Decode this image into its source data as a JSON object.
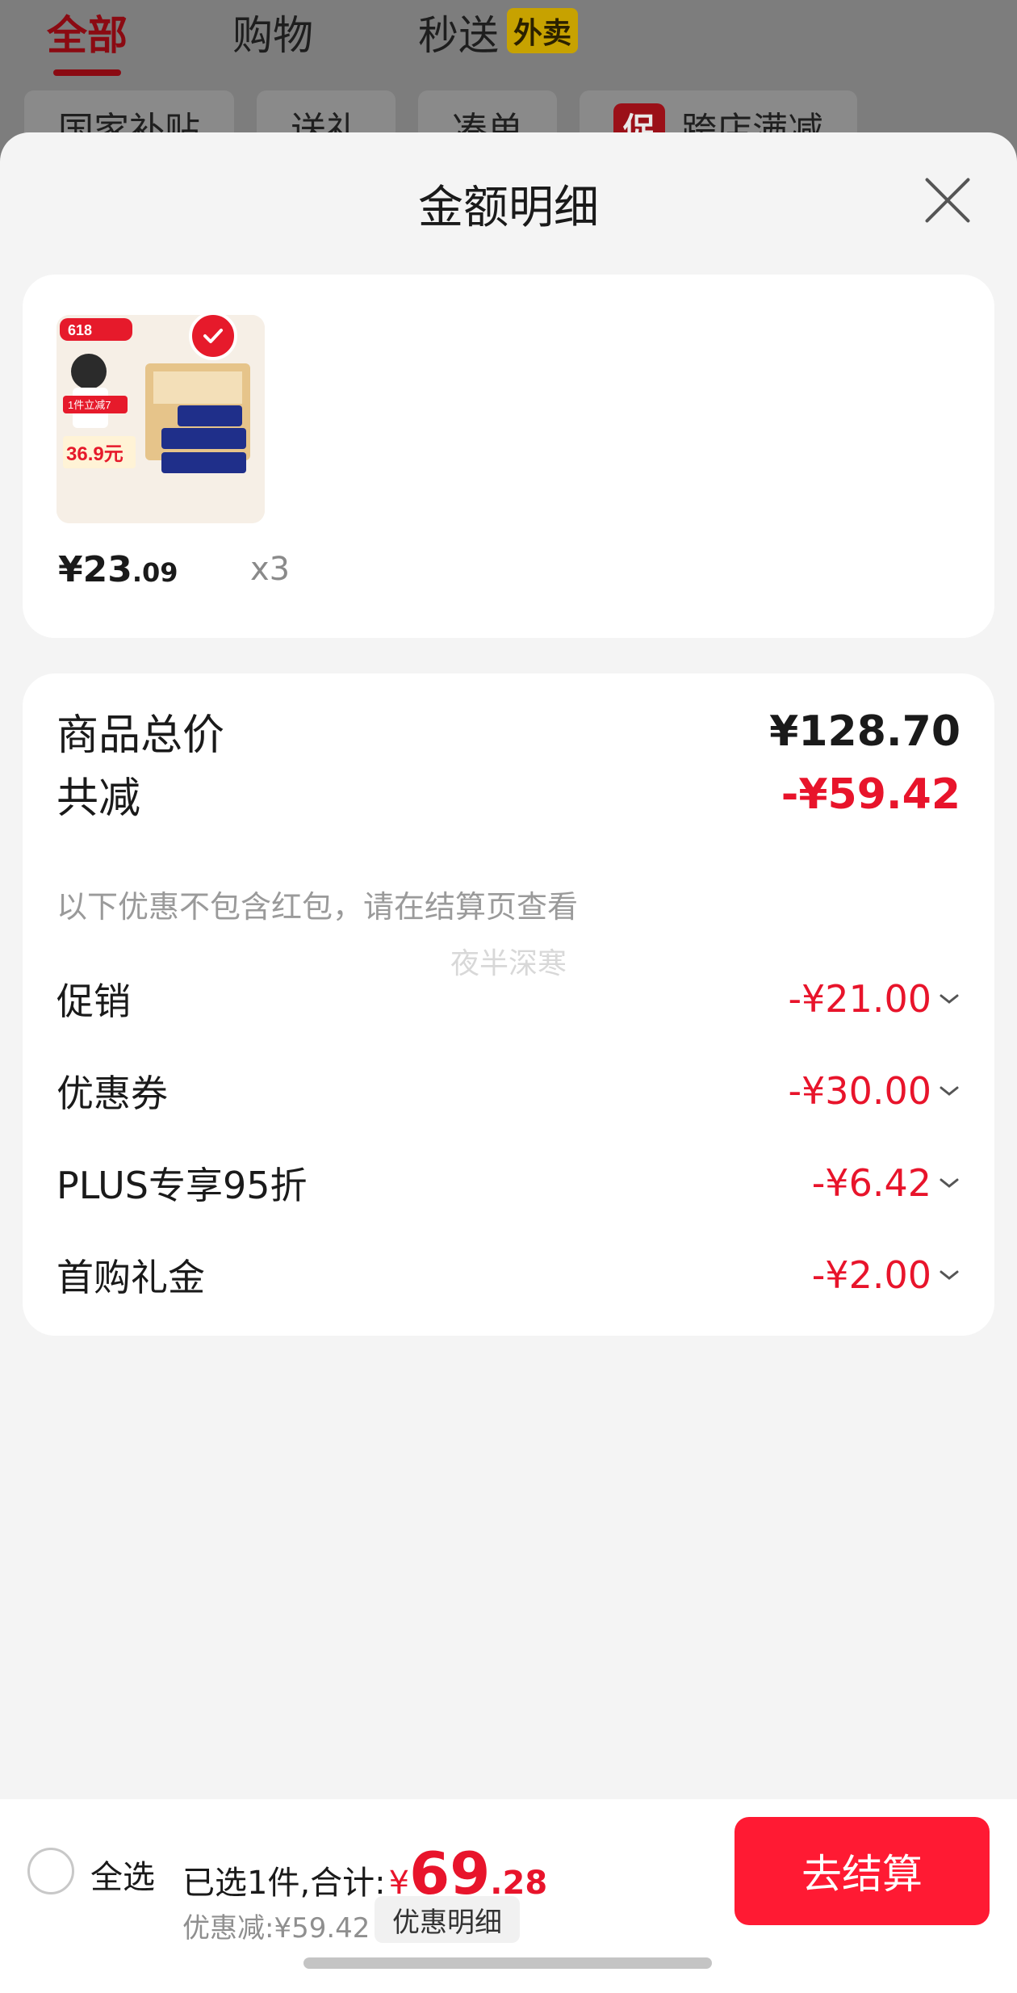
{
  "background": {
    "tabs": [
      "全部",
      "购物",
      "秒送"
    ],
    "tab_badge": "外卖",
    "chips": [
      "国家补贴",
      "送礼",
      "凑单",
      "跨店满减"
    ],
    "promo_tag": "促"
  },
  "sheet": {
    "title": "金额明细",
    "product": {
      "price_int": "¥23",
      "price_dec": ".09",
      "qty": "x3",
      "image_badge": "618",
      "image_tag": "1件立减7",
      "image_price": "36.9元"
    },
    "summary": {
      "total_label": "商品总价",
      "total_value": "¥128.70",
      "reduce_label": "共减",
      "reduce_value": "-¥59.42",
      "note": "以下优惠不包含红包，请在结算页查看",
      "watermark": "夜半深寒",
      "lines": [
        {
          "label": "促销",
          "value": "-¥21.00"
        },
        {
          "label": "优惠券",
          "value": "-¥30.00"
        },
        {
          "label": "PLUS专享95折",
          "value": "-¥6.42"
        },
        {
          "label": "首购礼金",
          "value": "-¥2.00"
        }
      ]
    }
  },
  "bottom": {
    "select_all": "全选",
    "selected_prefix": "已选1件,合计:",
    "total_yen": "¥",
    "total_int": "69",
    "total_dec": ".28",
    "discount": "优惠减:¥59.42",
    "detail_button": "优惠明细",
    "checkout_button": "去结算"
  },
  "colors": {
    "accent_red": "#e8142b",
    "checkout": "#ff1a33"
  }
}
